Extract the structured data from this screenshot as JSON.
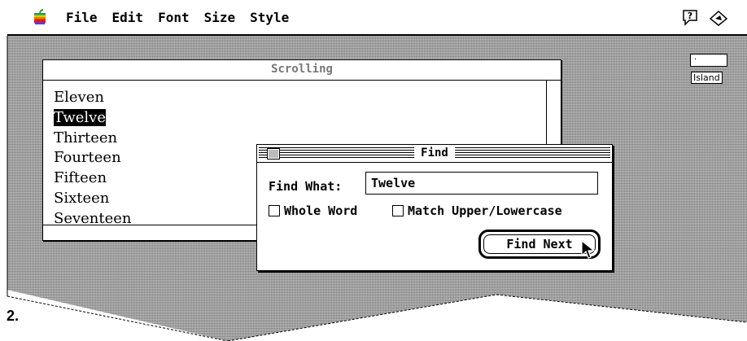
{
  "menubar": {
    "apple_icon": "apple-icon",
    "items": [
      "File",
      "Edit",
      "Font",
      "Size",
      "Style"
    ],
    "help_icon": "help-icon",
    "app_icon": "application-icon"
  },
  "desktop_icon": {
    "label": "Island",
    "icon_text": "."
  },
  "scrolling_window": {
    "title": "Scrolling",
    "items": [
      "Eleven",
      "Twelve",
      "Thirteen",
      "Fourteen",
      "Fifteen",
      "Sixteen",
      "Seventeen"
    ],
    "selected_index": 1
  },
  "find_dialog": {
    "title": "Find",
    "find_what_label": "Find What:",
    "find_what_value": "Twelve",
    "whole_word_label": "Whole Word",
    "match_case_label": "Match Upper/Lowercase",
    "whole_word_checked": false,
    "match_case_checked": false,
    "find_next_label": "Find Next"
  },
  "caption": "2."
}
